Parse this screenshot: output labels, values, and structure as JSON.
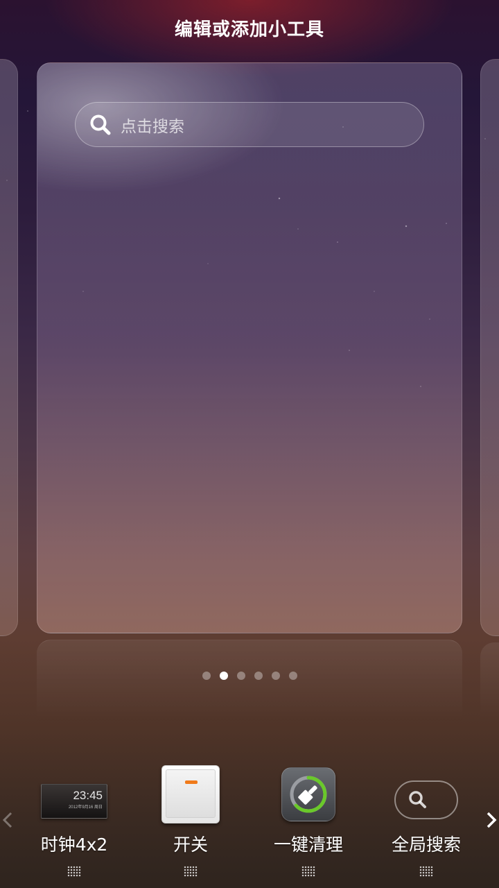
{
  "header": {
    "title": "编辑或添加小工具"
  },
  "preview": {
    "search_placeholder": "点击搜索",
    "page_count": 6,
    "active_page_index": 1
  },
  "widget_tray": {
    "items": [
      {
        "label": "时钟4x2",
        "preview_time": "23:45",
        "preview_date": "2012年9月16 周日",
        "icon": "clock-widget-icon"
      },
      {
        "label": "开关",
        "icon": "toggle-switch-icon"
      },
      {
        "label": "一键清理",
        "icon": "broom-clean-icon"
      },
      {
        "label": "全局搜索",
        "icon": "search-pill-icon"
      }
    ],
    "scroll_left_icon": "chevron-left-icon",
    "scroll_right_icon": "chevron-right-icon"
  },
  "colors": {
    "switch_led": "#f07a1a",
    "clean_ring": "#6ac92a",
    "active_dot": "#ffffff"
  }
}
